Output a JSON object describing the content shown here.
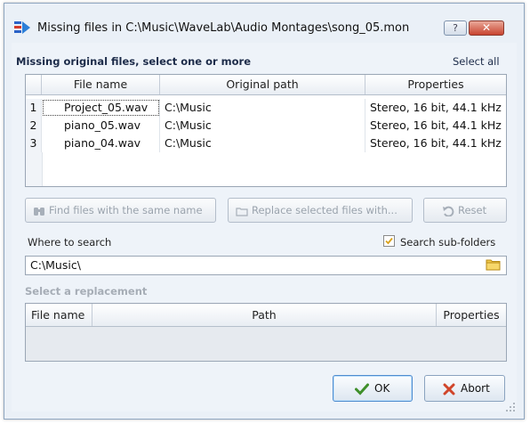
{
  "window": {
    "title": "Missing files in C:\\Music\\WaveLab\\Audio Montages\\song_05.mon",
    "help_label": "?",
    "close_label": "✕"
  },
  "missing": {
    "heading": "Missing original files, select one or more",
    "select_all": "Select all",
    "columns": [
      "File name",
      "Original path",
      "Properties"
    ],
    "rows": [
      {
        "num": "1",
        "file": "Project_05.wav",
        "path": "C:\\Music",
        "props": "Stereo, 16 bit, 44.1 kHz"
      },
      {
        "num": "2",
        "file": "piano_05.wav",
        "path": "C:\\Music",
        "props": "Stereo, 16 bit, 44.1 kHz"
      },
      {
        "num": "3",
        "file": "piano_04.wav",
        "path": "C:\\Music",
        "props": "Stereo, 16 bit, 44.1 kHz"
      }
    ]
  },
  "actions": {
    "find_same": "Find files with the same name",
    "replace_selected": "Replace selected files with...",
    "reset": "Reset"
  },
  "search": {
    "where_label": "Where to search",
    "subfolders_label": "Search sub-folders",
    "subfolders_checked": true,
    "path_value": "C:\\Music\\"
  },
  "replacement": {
    "heading": "Select a replacement",
    "columns": [
      "File name",
      "Path",
      "Properties"
    ]
  },
  "footer": {
    "ok_label": "OK",
    "abort_label": "Abort"
  },
  "colors": {
    "ok_check": "#3f8f2a",
    "abort_x": "#d0452a",
    "close_button": "#c9442f"
  }
}
